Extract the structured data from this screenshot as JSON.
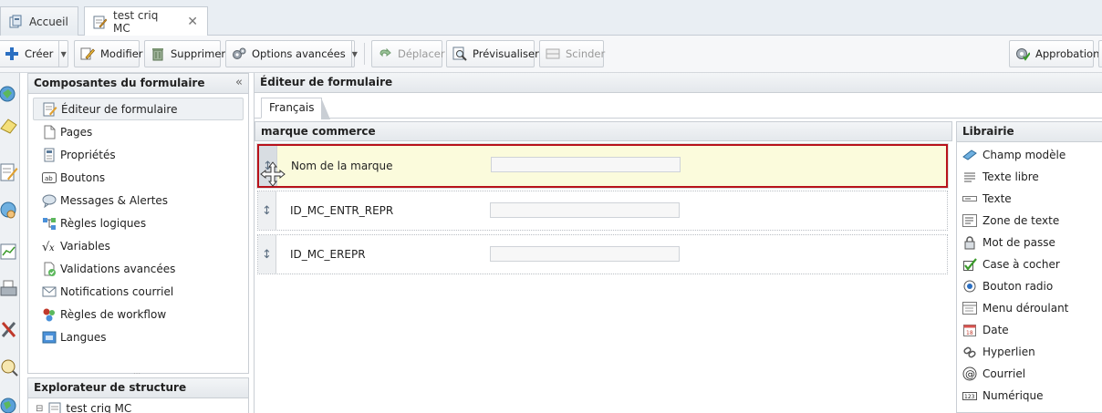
{
  "tabs": [
    {
      "label": "Accueil",
      "icon": "home-icon"
    },
    {
      "label": "test criq MC",
      "icon": "form-edit-icon",
      "active": true
    }
  ],
  "toolbar": {
    "create": "Créer",
    "modify": "Modifier",
    "delete": "Supprimer",
    "advanced": "Options avancées",
    "move": "Déplacer",
    "preview": "Prévisualiser",
    "split": "Scinder",
    "approval": "Approbation"
  },
  "left_panel": {
    "title": "Composantes du formulaire",
    "collapse_glyph": "«",
    "items": [
      {
        "label": "Éditeur de formulaire",
        "icon": "form-editor-icon",
        "selected": true
      },
      {
        "label": "Pages",
        "icon": "pages-icon"
      },
      {
        "label": "Propriétés",
        "icon": "properties-icon"
      },
      {
        "label": "Boutons",
        "icon": "buttons-icon"
      },
      {
        "label": "Messages & Alertes",
        "icon": "messages-icon"
      },
      {
        "label": "Règles logiques",
        "icon": "logic-rules-icon"
      },
      {
        "label": "Variables",
        "icon": "variables-icon"
      },
      {
        "label": "Validations avancées",
        "icon": "validations-icon"
      },
      {
        "label": "Notifications courriel",
        "icon": "email-notification-icon"
      },
      {
        "label": "Règles de workflow",
        "icon": "workflow-icon"
      },
      {
        "label": "Langues",
        "icon": "languages-icon"
      }
    ]
  },
  "explorer": {
    "title": "Explorateur de structure",
    "root": "test criq MC",
    "expander": "⊟"
  },
  "editor": {
    "title": "Éditeur de formulaire",
    "language_tab": "Français",
    "section_title": "marque commerce",
    "fields": [
      {
        "label": "Nom de la marque",
        "active": true
      },
      {
        "label": "ID_MC_ENTR_REPR"
      },
      {
        "label": "ID_MC_EREPR"
      }
    ]
  },
  "library": {
    "title": "Librairie",
    "items": [
      {
        "label": "Champ modèle",
        "icon": "template-field-icon"
      },
      {
        "label": "Texte libre",
        "icon": "free-text-icon"
      },
      {
        "label": "Texte",
        "icon": "text-field-icon"
      },
      {
        "label": "Zone de texte",
        "icon": "textarea-icon"
      },
      {
        "label": "Mot de passe",
        "icon": "password-lock-icon"
      },
      {
        "label": "Case à cocher",
        "icon": "checkbox-icon"
      },
      {
        "label": "Bouton radio",
        "icon": "radio-button-icon"
      },
      {
        "label": "Menu déroulant",
        "icon": "dropdown-menu-icon"
      },
      {
        "label": "Date",
        "icon": "calendar-icon"
      },
      {
        "label": "Hyperlien",
        "icon": "hyperlink-icon"
      },
      {
        "label": "Courriel",
        "icon": "email-at-icon"
      },
      {
        "label": "Numérique",
        "icon": "numeric-icon"
      }
    ]
  },
  "colors": {
    "active_border": "#b8121b",
    "active_bg": "#fbfbdc"
  }
}
